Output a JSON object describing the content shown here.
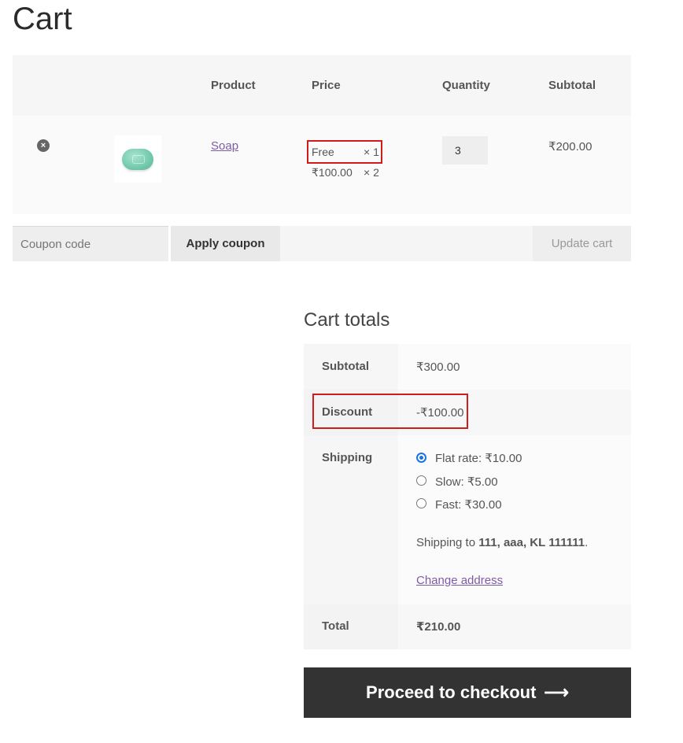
{
  "page": {
    "title": "Cart"
  },
  "table": {
    "headers": {
      "product": "Product",
      "price": "Price",
      "quantity": "Quantity",
      "subtotal": "Subtotal"
    },
    "row": {
      "remove_icon": "×",
      "product": "Soap",
      "price_lines": [
        {
          "price": "Free",
          "qty": "× 1"
        },
        {
          "price": "₹100.00",
          "qty": "× 2"
        }
      ],
      "quantity": "3",
      "subtotal": "₹200.00"
    }
  },
  "coupon": {
    "placeholder": "Coupon code",
    "apply_label": "Apply coupon",
    "update_label": "Update cart"
  },
  "totals": {
    "title": "Cart totals",
    "subtotal_label": "Subtotal",
    "subtotal_value": "₹300.00",
    "discount_label": "Discount",
    "discount_value": "-₹100.00",
    "shipping_label": "Shipping",
    "shipping_options": [
      {
        "label": "Flat rate: ₹10.00",
        "checked": true
      },
      {
        "label": "Slow: ₹5.00",
        "checked": false
      },
      {
        "label": "Fast: ₹30.00",
        "checked": false
      }
    ],
    "shipping_to_prefix": "Shipping to ",
    "shipping_address": "111, aaa, KL 111111",
    "shipping_to_suffix": ".",
    "change_address": "Change address",
    "total_label": "Total",
    "total_value": "₹210.00"
  },
  "checkout": {
    "label": "Proceed to checkout",
    "arrow": "⟶"
  },
  "colors": {
    "highlight_border": "#d01c1c",
    "link": "#7e5ca5",
    "checkout_bg": "#333333"
  }
}
